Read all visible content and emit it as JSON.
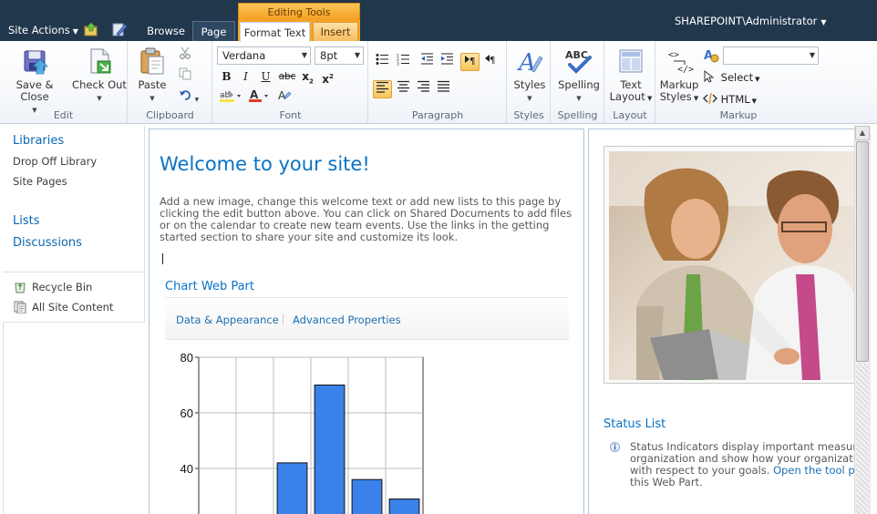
{
  "topbar": {
    "site_actions": "Site Actions",
    "tab_browse": "Browse",
    "tab_page": "Page",
    "editing_tools": "Editing Tools",
    "tab_format_text": "Format Text",
    "tab_insert": "Insert",
    "user": "SHAREPOINT\\Administrator"
  },
  "ribbon": {
    "edit": {
      "label": "Edit",
      "save_close": "Save & Close",
      "check_out": "Check Out"
    },
    "clipboard": {
      "label": "Clipboard",
      "paste": "Paste"
    },
    "font": {
      "label": "Font",
      "font_name": "Verdana",
      "font_size": "8pt",
      "bold": "B",
      "italic": "I",
      "underline": "U",
      "strike": "abc",
      "subscript": "x",
      "superscript": "x"
    },
    "paragraph": {
      "label": "Paragraph"
    },
    "styles": {
      "label": "Styles",
      "button": "Styles"
    },
    "spelling": {
      "label": "Spelling",
      "button": "Spelling"
    },
    "layout": {
      "label": "Layout",
      "text_layout_1": "Text",
      "text_layout_2": "Layout"
    },
    "markup": {
      "label": "Markup",
      "markup_styles_1": "Markup",
      "markup_styles_2": "Styles",
      "select": "Select",
      "html": "HTML",
      "combo_value": ""
    }
  },
  "leftnav": {
    "libraries": "Libraries",
    "drop_off_library": "Drop Off Library",
    "site_pages": "Site Pages",
    "lists": "Lists",
    "discussions": "Discussions",
    "recycle_bin": "Recycle Bin",
    "all_site_content": "All Site Content"
  },
  "main": {
    "title": "Welcome to your site!",
    "body": "Add a new image, change this welcome text or add new lists to this page by clicking the edit button above. You can click on Shared Documents to add files or on the calendar to create new team events. Use the links in the getting started section to share your site and customize its look.",
    "chart_webpart_title": "Chart Web Part",
    "data_appearance": "Data & Appearance",
    "advanced_properties": "Advanced Properties"
  },
  "chart_data": {
    "type": "bar",
    "categories": [
      "",
      "",
      "",
      "",
      "",
      ""
    ],
    "values": [
      null,
      null,
      42,
      70,
      36,
      29
    ],
    "yticks": [
      40,
      60,
      80
    ],
    "ylim": [
      0,
      80
    ],
    "bar_color": "#3a81ea",
    "grid": true
  },
  "rightcol": {
    "status_title": "Status List",
    "status_line1": "Status Indicators display important measur",
    "status_line2": "organization and show how your organizati",
    "status_line3_a": "with respect to your goals. ",
    "status_link": "Open the tool pa",
    "status_line4": "this Web Part."
  },
  "colors": {
    "topbar": "#21374c",
    "accent": "#0a72c4",
    "context_orange": "#f4a32a"
  }
}
